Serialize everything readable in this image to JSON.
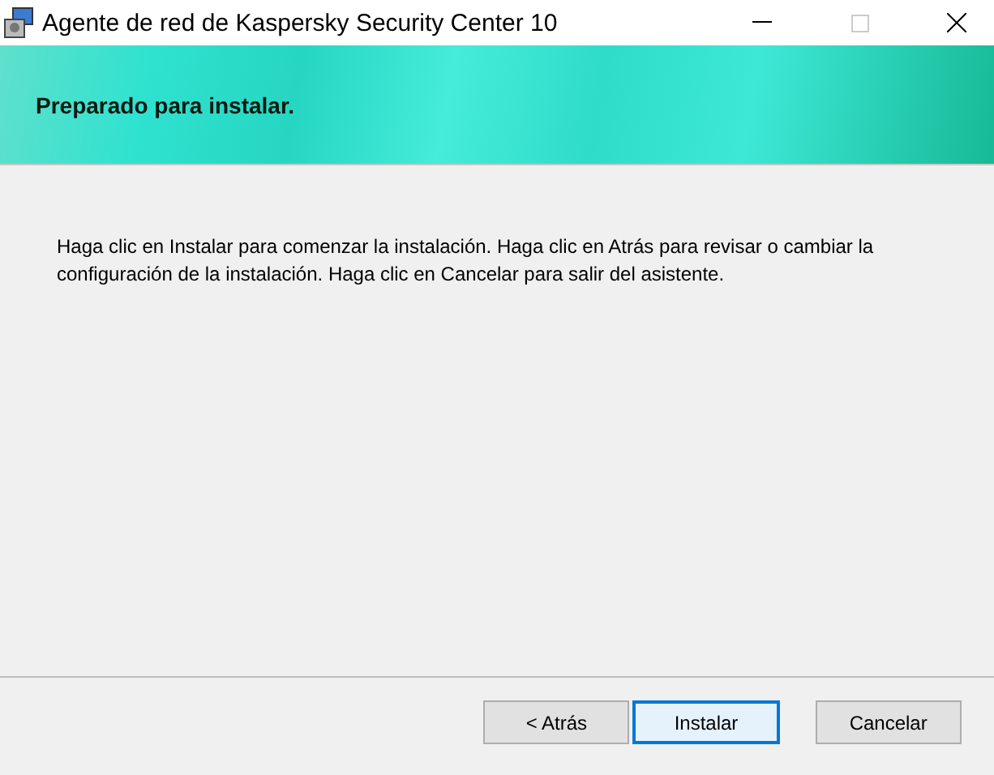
{
  "window": {
    "title": "Agente de red de Kaspersky Security Center 10"
  },
  "banner": {
    "title": "Preparado para instalar."
  },
  "body": {
    "text": "Haga clic en Instalar para comenzar la instalación. Haga clic en Atrás para revisar o cambiar la configuración de la instalación. Haga clic en Cancelar para salir del asistente."
  },
  "buttons": [
    {
      "label": "< Atrás",
      "default": false
    },
    {
      "label": "Instalar",
      "default": true
    },
    {
      "label": "Cancelar",
      "default": false
    }
  ]
}
